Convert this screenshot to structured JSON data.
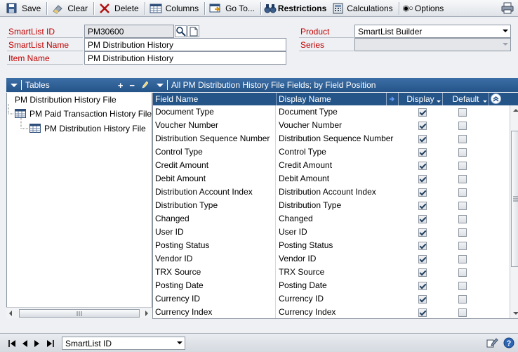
{
  "toolbar": {
    "save": "Save",
    "clear": "Clear",
    "delete": "Delete",
    "columns": "Columns",
    "goto": "Go To...",
    "restrictions": "Restrictions",
    "calculations": "Calculations",
    "options": "Options"
  },
  "form": {
    "smartlist_id_label": "SmartList ID",
    "smartlist_id_value": "PM30600",
    "smartlist_name_label": "SmartList Name",
    "smartlist_name_value": "PM Distribution History",
    "item_name_label": "Item Name",
    "item_name_value": "PM Distribution History",
    "product_label": "Product",
    "product_value": "SmartList Builder",
    "series_label": "Series",
    "series_value": ""
  },
  "tables": {
    "header": "Tables",
    "items": [
      "PM Distribution History File",
      "PM Paid Transaction History File",
      "PM Distribution History File"
    ]
  },
  "grid": {
    "header": "All PM Distribution History File Fields; by Field Position",
    "columns": {
      "field_name": "Field Name",
      "display_name": "Display Name",
      "display": "Display",
      "default": "Default"
    },
    "rows": [
      {
        "field": "Document Type",
        "display_name": "Document Type",
        "display": true,
        "default": false
      },
      {
        "field": "Voucher Number",
        "display_name": "Voucher Number",
        "display": true,
        "default": false
      },
      {
        "field": "Distribution Sequence Number",
        "display_name": "Distribution Sequence Number",
        "display": true,
        "default": false
      },
      {
        "field": "Control Type",
        "display_name": "Control Type",
        "display": true,
        "default": false
      },
      {
        "field": "Credit Amount",
        "display_name": "Credit Amount",
        "display": true,
        "default": false
      },
      {
        "field": "Debit Amount",
        "display_name": "Debit Amount",
        "display": true,
        "default": false
      },
      {
        "field": "Distribution Account Index",
        "display_name": "Distribution Account Index",
        "display": true,
        "default": false
      },
      {
        "field": "Distribution Type",
        "display_name": "Distribution Type",
        "display": true,
        "default": false
      },
      {
        "field": "Changed",
        "display_name": "Changed",
        "display": true,
        "default": false
      },
      {
        "field": "User ID",
        "display_name": "User ID",
        "display": true,
        "default": false
      },
      {
        "field": "Posting Status",
        "display_name": "Posting Status",
        "display": true,
        "default": false
      },
      {
        "field": "Vendor ID",
        "display_name": "Vendor ID",
        "display": true,
        "default": false
      },
      {
        "field": "TRX Source",
        "display_name": "TRX Source",
        "display": true,
        "default": false
      },
      {
        "field": "Posting Date",
        "display_name": "Posting Date",
        "display": true,
        "default": false
      },
      {
        "field": "Currency ID",
        "display_name": "Currency ID",
        "display": true,
        "default": false
      },
      {
        "field": "Currency Index",
        "display_name": "Currency Index",
        "display": true,
        "default": false
      }
    ]
  },
  "bottom": {
    "sort_value": "SmartList ID"
  },
  "colors": {
    "label_red": "#c00000",
    "header_blue": "#245488"
  }
}
